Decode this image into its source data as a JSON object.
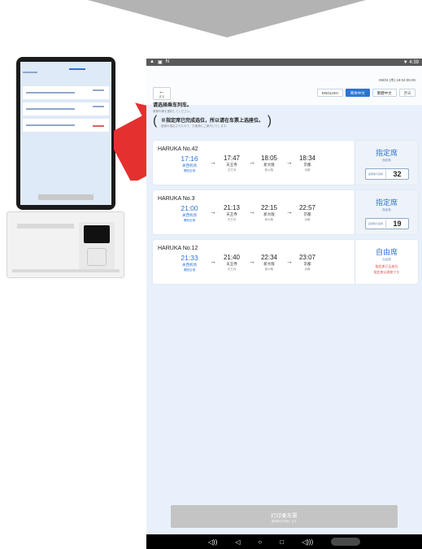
{
  "status_bar": {
    "left_icons": [
      "warning-icon",
      "image-icon",
      "n-icon"
    ],
    "time": "4:39"
  },
  "header": {
    "back_arrow": "←",
    "back_label": "戻る",
    "datetime": "09/03 (木) 19:04:05:00",
    "languages": [
      {
        "label": "ENGLISH",
        "active": false
      },
      {
        "label": "简体中文",
        "active": true
      },
      {
        "label": "繁體中文",
        "active": false
      },
      {
        "label": "한국",
        "active": false
      }
    ]
  },
  "instruction": {
    "title": "请选择乘车列车。",
    "subtitle": "乗車列車を選択してください。"
  },
  "notice": {
    "title": "※指定席已完成选位，所以请在车票上选座位。",
    "subtitle": "座席の指定されたので、お座席にご案内いたします。"
  },
  "trains": [
    {
      "name": "HARUKA No.42",
      "stops": [
        {
          "time": "17:16",
          "station": "关西机场",
          "sub": "関西空港"
        },
        {
          "time": "17:47",
          "station": "天王寺",
          "sub": "天王寺"
        },
        {
          "time": "18:05",
          "station": "新大阪",
          "sub": "新大阪"
        },
        {
          "time": "18:34",
          "station": "京都",
          "sub": "京都"
        }
      ],
      "seat_type": "指定席",
      "seat_type_sub": "指定席",
      "seat_label": "座席数可选择",
      "seat_count": "32"
    },
    {
      "name": "HARUKA No.3",
      "stops": [
        {
          "time": "21:00",
          "station": "关西机场",
          "sub": "関西空港"
        },
        {
          "time": "21:13",
          "station": "天王寺",
          "sub": "天王寺"
        },
        {
          "time": "22:15",
          "station": "新大阪",
          "sub": "新大阪"
        },
        {
          "time": "22:57",
          "station": "京都",
          "sub": "京都"
        }
      ],
      "seat_type": "指定席",
      "seat_type_sub": "指定席",
      "seat_label": "座席数可选择",
      "seat_count": "19"
    },
    {
      "name": "HARUKA No.12",
      "stops": [
        {
          "time": "21:33",
          "station": "关西机场",
          "sub": "関西空港"
        },
        {
          "time": "21:40",
          "station": "天王寺",
          "sub": "天王寺"
        },
        {
          "time": "22:34",
          "station": "新大阪",
          "sub": "新大阪"
        },
        {
          "time": "23:07",
          "station": "京都",
          "sub": "京都"
        }
      ],
      "seat_type": "自由席",
      "seat_type_sub": "自由席",
      "warning_1": "指定席已无座位",
      "warning_2": "指定席は満席です"
    }
  ],
  "print_button": {
    "label": "打印乘车票",
    "sublabel": "乗車券を印刷します"
  },
  "navbar_icons": [
    "volume-down-icon",
    "back-icon",
    "home-icon",
    "recents-icon",
    "volume-up-icon",
    "screenshot-icon"
  ],
  "colors": {
    "accent": "#2b74d6",
    "warning": "#d9534f",
    "arrow_red": "#e53030",
    "background": "#e8f1fb"
  }
}
